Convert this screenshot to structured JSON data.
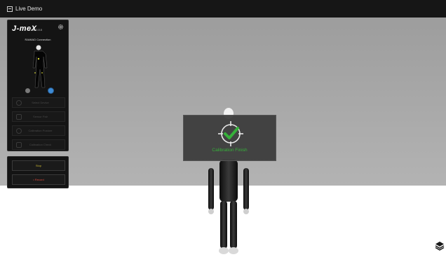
{
  "window": {
    "title": "Live Demo"
  },
  "panel": {
    "logo": "J-meX",
    "version": "Ver 2.0.0",
    "connection_text": "RAMIAD  Connection",
    "buttons": [
      {
        "label": "Select Device",
        "icon": "target-icon"
      },
      {
        "label": "Sensor Pair",
        "icon": "document-icon"
      },
      {
        "label": "Calibration Posture",
        "icon": "refresh-icon"
      },
      {
        "label": "Calibration Check",
        "icon": "tools-icon"
      }
    ]
  },
  "record_panel": {
    "stop_label": "Stop",
    "record_label": "• Record"
  },
  "dialog": {
    "message": "Calibration Finish"
  },
  "colors": {
    "accent_green": "#36b13a",
    "record_red": "#d9483b",
    "stop_yellow": "#c9b632",
    "status_blue": "#3d8bd6"
  }
}
